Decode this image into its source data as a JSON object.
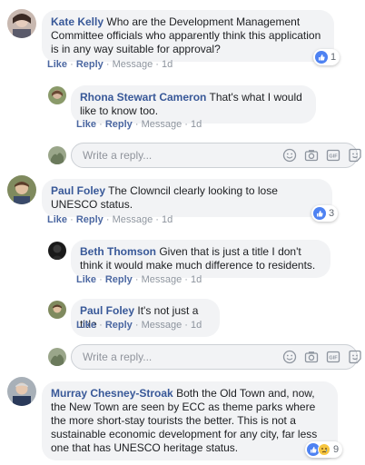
{
  "actions": {
    "like": "Like",
    "reply": "Reply",
    "message": "Message"
  },
  "reply_placeholder": "Write a reply...",
  "comments": [
    {
      "name": "Kate Kelly",
      "text": "Who are the Development Management Committee officials who apparently think this application is in any way suitable for approval?",
      "time": "1d",
      "reactions": "1"
    },
    {
      "name": "Rhona Stewart Cameron",
      "text": "That's what I would like to know too.",
      "time": "1d"
    },
    {
      "name": "Paul Foley",
      "text": "The Clowncil clearly looking to lose UNESCO status.",
      "time": "1d",
      "reactions": "3"
    },
    {
      "name": "Beth Thomson",
      "text": "Given that is just a title I don't think it would make much difference to residents.",
      "time": "1d"
    },
    {
      "name": "Paul Foley",
      "text": "It's not just a title",
      "time": "1d"
    },
    {
      "name": "Murray Chesney-Stroak",
      "text": "Both the Old Town and, now, the New Town are seen by ECC as theme parks where the more short-stay tourists the better. This is not a sustainable economic development for any city, far less one that has UNESCO heritage status.",
      "reactions": "9"
    }
  ],
  "colors": {
    "link": "#385898",
    "bubble": "#f2f3f5",
    "like": "#4e82f2"
  }
}
